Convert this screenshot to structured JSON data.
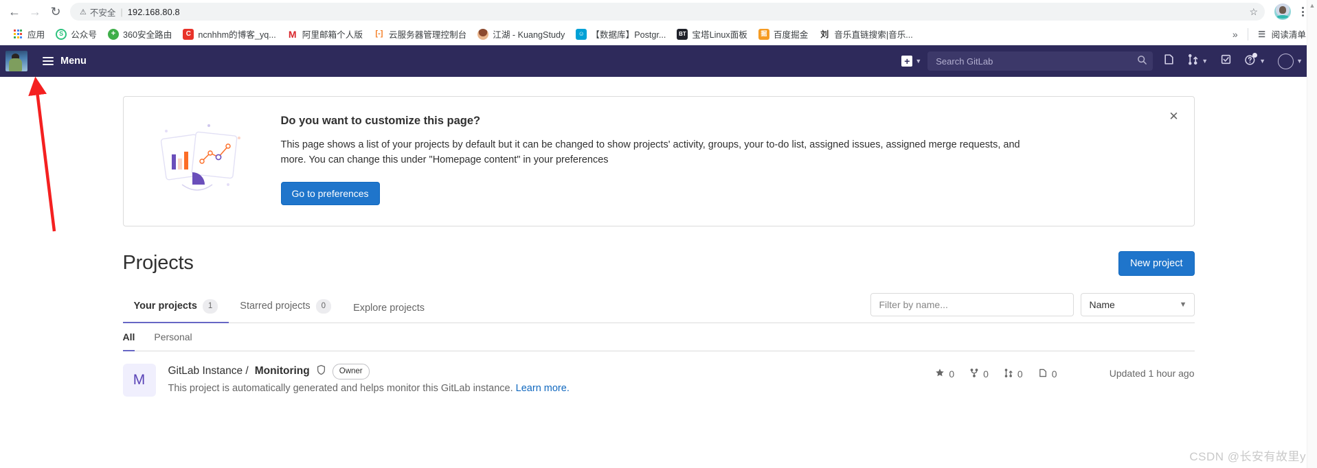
{
  "browser": {
    "back_icon": "back-arrow-icon",
    "forward_icon": "forward-arrow-icon",
    "reload_icon": "reload-icon",
    "security_label": "不安全",
    "url": "192.168.80.8",
    "star_icon": "bookmark-star-icon",
    "menu_icon": "browser-menu-icon",
    "bookmarks": [
      {
        "label": "应用",
        "icon": "apps-grid-icon",
        "color": "#4285f4",
        "glyph": ""
      },
      {
        "label": "公众号",
        "icon": "wechat-official-icon",
        "color": "#2ec27e",
        "glyph": "S"
      },
      {
        "label": "360安全路由",
        "icon": "360-router-icon",
        "color": "#3fae49",
        "glyph": "+"
      },
      {
        "label": "ncnhhm的博客_yq...",
        "icon": "csdn-blog-icon",
        "color": "#e8332a",
        "glyph": "C"
      },
      {
        "label": "阿里邮箱个人版",
        "icon": "aliyun-mail-icon",
        "color": "#ffffff",
        "glyph": "M"
      },
      {
        "label": "云服务器管理控制台",
        "icon": "cloud-console-icon",
        "color": "#ffffff",
        "glyph": "[-]"
      },
      {
        "label": "江湖 - KuangStudy",
        "icon": "kuangstudy-icon",
        "color": "#c0392b",
        "glyph": ""
      },
      {
        "label": "【数据库】Postgr...",
        "icon": "bilibili-icon",
        "color": "#00a1d6",
        "glyph": ""
      },
      {
        "label": "宝塔Linux面板",
        "icon": "baota-panel-icon",
        "color": "#20222a",
        "glyph": "BT"
      },
      {
        "label": "百度掘金",
        "icon": "juejin-icon",
        "color": "#f59b23",
        "glyph": "掘"
      },
      {
        "label": "音乐直链搜索|音乐...",
        "icon": "music-search-icon",
        "color": "#ffffff",
        "glyph": "刘"
      }
    ],
    "overflow_label": "»",
    "reading_list_label": "阅读清单",
    "reading_list_icon": "reading-list-icon"
  },
  "gitlab_nav": {
    "logo_icon": "gitlab-user-avatar-logo",
    "menu_label": "Menu",
    "menu_icon": "hamburger-icon",
    "create_new_icon": "plus-square-icon",
    "create_new_chevron": "chevron-down-icon",
    "search_placeholder": "Search GitLab",
    "search_icon": "search-icon",
    "issues_icon": "issues-icon",
    "merge_requests_icon": "merge-request-icon",
    "merge_requests_chevron": "chevron-down-icon",
    "todo_icon": "todo-checkbox-icon",
    "help_icon": "help-question-icon",
    "help_chevron": "chevron-down-icon",
    "avatar_icon": "user-avatar-icon",
    "avatar_chevron": "chevron-down-icon"
  },
  "banner": {
    "title": "Do you want to customize this page?",
    "text": "This page shows a list of your projects by default but it can be changed to show projects' activity, groups, your to-do list, assigned issues, assigned merge requests, and more. You can change this under \"Homepage content\" in your preferences",
    "cta_label": "Go to preferences",
    "close_icon": "close-x-icon",
    "illustration_icon": "dashboard-cards-illustration"
  },
  "projects_page": {
    "title": "Projects",
    "new_project_label": "New project",
    "tabs": [
      {
        "label": "Your projects",
        "count": "1",
        "active": true
      },
      {
        "label": "Starred projects",
        "count": "0",
        "active": false
      },
      {
        "label": "Explore projects",
        "count": "",
        "active": false
      }
    ],
    "filter_placeholder": "Filter by name...",
    "sort_value": "Name",
    "sort_chevron": "chevron-down-icon",
    "subtabs": [
      {
        "label": "All",
        "active": true
      },
      {
        "label": "Personal",
        "active": false
      }
    ],
    "rows": [
      {
        "avatar_letter": "M",
        "namespace": "GitLab Instance /",
        "name": "Monitoring",
        "shield_icon": "shield-icon",
        "access_badge": "Owner",
        "description": "This project is automatically generated and helps monitor this GitLab instance.",
        "description_link": "Learn more.",
        "stars": "0",
        "forks": "0",
        "merge_requests": "0",
        "issues": "0",
        "updated": "Updated 1 hour ago"
      }
    ]
  },
  "annotation": {
    "arrow_icon": "red-arrow-annotation",
    "arrow_color": "#f42020"
  },
  "watermark": "CSDN @长安有故里y"
}
